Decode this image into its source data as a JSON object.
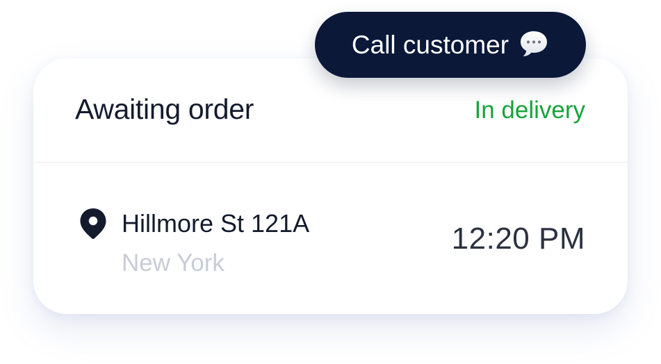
{
  "order_card": {
    "title": "Awaiting order",
    "status": "In delivery",
    "status_color": "#17a33a",
    "address": "Hillmore St 121A",
    "city": "New York",
    "time": "12:20 PM",
    "location_icon": "map-pin-icon"
  },
  "call_button": {
    "label": "Call customer",
    "icon": "speech-bubble-icon",
    "background_color": "#0b1838"
  }
}
